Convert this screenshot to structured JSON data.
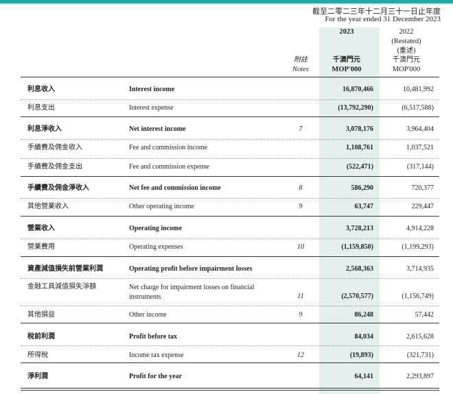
{
  "header": {
    "period_zh": "截至二零二三年十二月三十一日止年度",
    "period_en": "For the year ended 31 December 2023"
  },
  "columns": {
    "notes_zh": "附註",
    "notes_en": "Notes",
    "y2023": "2023",
    "y2023_unit_zh": "千澳門元",
    "y2023_unit_en": "MOP'000",
    "y2022": "2022",
    "y2022_restated_en": "(Restated)",
    "y2022_restated_zh": "(重述)",
    "y2022_unit_zh": "千澳門元",
    "y2022_unit_en": "MOP'000"
  },
  "rows": [
    {
      "zh": "利息收入",
      "en": "Interest income",
      "note": "",
      "v2023": "16,870,466",
      "v2022": "10,481,992",
      "bold": true
    },
    {
      "zh": "利息支出",
      "en": "Interest expense",
      "note": "",
      "v2023": "(13,792,290)",
      "v2022": "(6,517,588)",
      "bold": false
    },
    {
      "zh": "利息淨收入",
      "en": "Net interest income",
      "note": "7",
      "v2023": "3,078,176",
      "v2022": "3,964,404",
      "bold": true
    },
    {
      "zh": "手續費及佣金收入",
      "en": "Fee and commission income",
      "note": "",
      "v2023": "1,108,761",
      "v2022": "1,037,521",
      "bold": false
    },
    {
      "zh": "手續費及佣金支出",
      "en": "Fee and commission expense",
      "note": "",
      "v2023": "(522,471)",
      "v2022": "(317,144)",
      "bold": false
    },
    {
      "zh": "手續費及佣金淨收入",
      "en": "Net fee and commission income",
      "note": "8",
      "v2023": "586,290",
      "v2022": "720,377",
      "bold": true
    },
    {
      "zh": "其他營業收入",
      "en": "Other operating income",
      "note": "9",
      "v2023": "63,747",
      "v2022": "229,447",
      "bold": false
    },
    {
      "zh": "營業收入",
      "en": "Operating income",
      "note": "",
      "v2023": "3,728,213",
      "v2022": "4,914,228",
      "bold": true
    },
    {
      "zh": "營業費用",
      "en": "Operating expenses",
      "note": "10",
      "v2023": "(1,159,850)",
      "v2022": "(1,199,293)",
      "bold": false
    },
    {
      "zh": "資產減值損失前營業利潤",
      "en": "Operating profit before impairment losses",
      "note": "",
      "v2023": "2,568,363",
      "v2022": "3,714,935",
      "bold": true
    },
    {
      "zh": "金融工具減值損失淨額",
      "en": "Net charge for impairment losses on financial instruments",
      "note": "11",
      "v2023": "(2,570,577)",
      "v2022": "(1,156,749)",
      "bold": false
    },
    {
      "zh": "其他損益",
      "en": "Other income",
      "note": "9",
      "v2023": "86,248",
      "v2022": "57,442",
      "bold": false
    },
    {
      "zh": "稅前利潤",
      "en": "Profit before tax",
      "note": "",
      "v2023": "84,034",
      "v2022": "2,615,628",
      "bold": true
    },
    {
      "zh": "所得稅",
      "en": "Income tax expense",
      "note": "12",
      "v2023": "(19,893)",
      "v2022": "(321,731)",
      "bold": false
    },
    {
      "zh": "淨利潤",
      "en": "Profit for the year",
      "note": "",
      "v2023": "64,141",
      "v2022": "2,293,897",
      "bold": true
    }
  ]
}
